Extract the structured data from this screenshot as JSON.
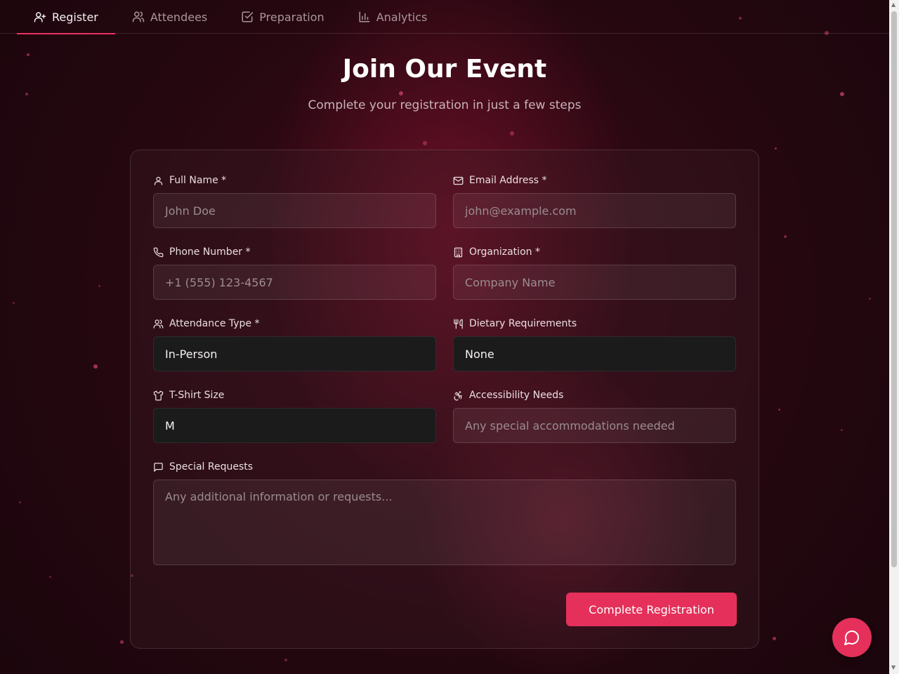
{
  "nav": {
    "tabs": [
      {
        "label": "Register",
        "icon": "user-plus-icon",
        "active": true
      },
      {
        "label": "Attendees",
        "icon": "users-icon",
        "active": false
      },
      {
        "label": "Preparation",
        "icon": "check-square-icon",
        "active": false
      },
      {
        "label": "Analytics",
        "icon": "bar-chart-icon",
        "active": false
      }
    ]
  },
  "hero": {
    "title": "Join Our Event",
    "subtitle": "Complete your registration in just a few steps"
  },
  "form": {
    "full_name": {
      "label": "Full Name *",
      "placeholder": "John Doe",
      "icon": "user-icon"
    },
    "email": {
      "label": "Email Address *",
      "placeholder": "john@example.com",
      "icon": "mail-icon"
    },
    "phone": {
      "label": "Phone Number *",
      "placeholder": "+1 (555) 123-4567",
      "icon": "phone-icon"
    },
    "organization": {
      "label": "Organization *",
      "placeholder": "Company Name",
      "icon": "building-icon"
    },
    "attendance": {
      "label": "Attendance Type *",
      "value": "In-Person",
      "icon": "users-icon"
    },
    "dietary": {
      "label": "Dietary Requirements",
      "value": "None",
      "icon": "utensils-icon"
    },
    "tshirt": {
      "label": "T-Shirt Size",
      "value": "M",
      "icon": "shirt-icon"
    },
    "accessibility": {
      "label": "Accessibility Needs",
      "placeholder": "Any special accommodations needed",
      "icon": "accessibility-icon"
    },
    "special": {
      "label": "Special Requests",
      "placeholder": "Any additional information or requests...",
      "icon": "message-square-icon"
    },
    "submit_label": "Complete Registration"
  },
  "colors": {
    "accent": "#e4305a",
    "background": "#24070f"
  },
  "chat": {
    "icon": "message-circle-icon"
  }
}
